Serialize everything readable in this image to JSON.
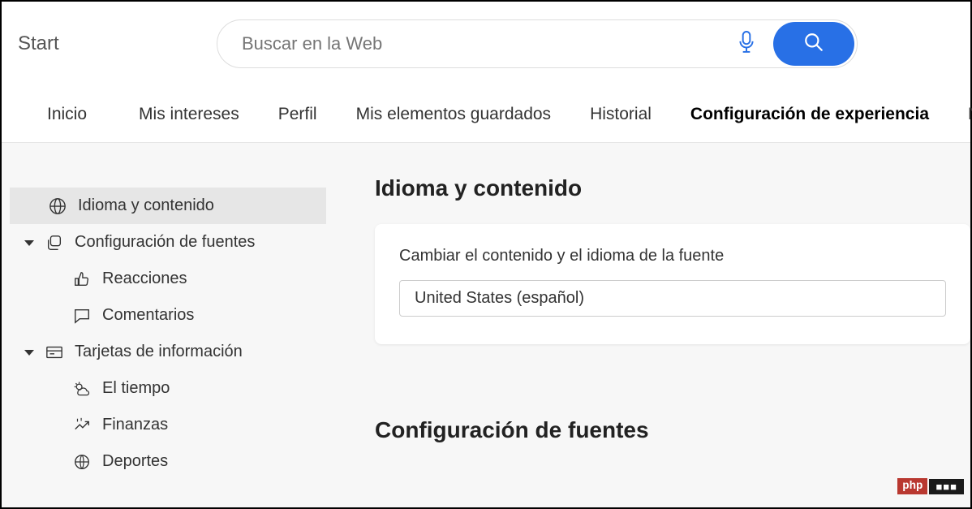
{
  "brand": "Start",
  "search": {
    "placeholder": "Buscar en la Web"
  },
  "nav": {
    "items": [
      {
        "label": "Inicio"
      },
      {
        "label": "Mis intereses"
      },
      {
        "label": "Perfil"
      },
      {
        "label": "Mis elementos guardados"
      },
      {
        "label": "Historial"
      },
      {
        "label": "Configuración de experiencia",
        "active": true
      },
      {
        "label": "Not"
      }
    ]
  },
  "sidebar": {
    "items": [
      {
        "label": "Idioma y contenido"
      },
      {
        "label": "Configuración de fuentes"
      },
      {
        "label": "Reacciones"
      },
      {
        "label": "Comentarios"
      },
      {
        "label": "Tarjetas de información"
      },
      {
        "label": "El tiempo"
      },
      {
        "label": "Finanzas"
      },
      {
        "label": "Deportes"
      }
    ]
  },
  "content": {
    "section1_title": "Idioma y contenido",
    "card1_label": "Cambiar el contenido y el idioma de la fuente",
    "card1_value": "United States (español)",
    "section2_title": "Configuración de fuentes"
  },
  "watermark": {
    "left": "php",
    "right": "■■■"
  }
}
